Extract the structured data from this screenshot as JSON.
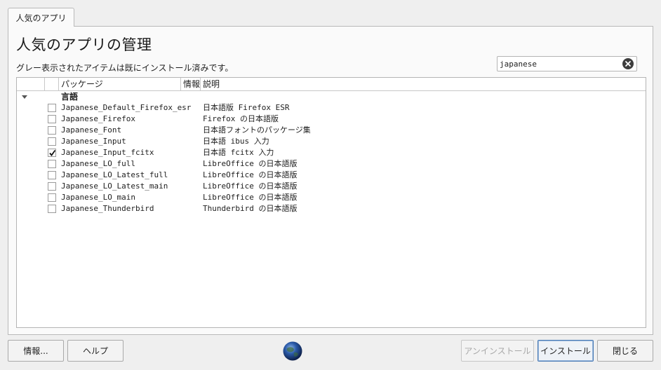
{
  "tab": {
    "label": "人気のアプリ"
  },
  "header": {
    "title": "人気のアプリの管理",
    "subtitle": "グレー表示されたアイテムは既にインストール済みです。"
  },
  "search": {
    "value": "japanese",
    "clear_icon": "clear-icon"
  },
  "table": {
    "columns": {
      "package": "パッケージ",
      "info": "情報",
      "description": "説明"
    },
    "group": {
      "label": "言語",
      "expanded": true
    },
    "rows": [
      {
        "package": "Japanese_Default_Firefox_esr",
        "description": "日本語版 Firefox ESR",
        "checked": false
      },
      {
        "package": "Japanese_Firefox",
        "description": "Firefox の日本語版",
        "checked": false
      },
      {
        "package": "Japanese_Font",
        "description": "日本語フォントのパッケージ集",
        "checked": false
      },
      {
        "package": "Japanese_Input",
        "description": "日本語 ibus 入力",
        "checked": false
      },
      {
        "package": "Japanese_Input_fcitx",
        "description": "日本語 fcitx 入力",
        "checked": true
      },
      {
        "package": "Japanese_LO_full",
        "description": "LibreOffice の日本語版",
        "checked": false
      },
      {
        "package": "Japanese_LO_Latest_full",
        "description": "LibreOffice の日本語版",
        "checked": false
      },
      {
        "package": "Japanese_LO_Latest_main",
        "description": "LibreOffice の日本語版",
        "checked": false
      },
      {
        "package": "Japanese_LO_main",
        "description": "LibreOffice の日本語版",
        "checked": false
      },
      {
        "package": "Japanese_Thunderbird",
        "description": "Thunderbird の日本語版",
        "checked": false
      }
    ]
  },
  "footer": {
    "info_button": "情報...",
    "help_button": "ヘルプ",
    "uninstall_button": "アンインストール",
    "install_button": "インストール",
    "close_button": "閉じる",
    "logo_icon": "globe-icon"
  }
}
